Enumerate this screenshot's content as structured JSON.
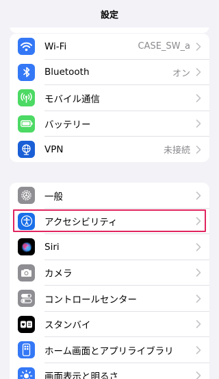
{
  "nav": {
    "title": "設定"
  },
  "group1": [
    {
      "label": "Wi-Fi",
      "value": "CASE_SW_a",
      "icon": "wifi-icon",
      "color": "#3478f6"
    },
    {
      "label": "Bluetooth",
      "value": "オン",
      "icon": "bluetooth-icon",
      "color": "#3478f6"
    },
    {
      "label": "モバイル通信",
      "value": "",
      "icon": "cellular-icon",
      "color": "#4cd964"
    },
    {
      "label": "バッテリー",
      "value": "",
      "icon": "battery-icon",
      "color": "#4cd964"
    },
    {
      "label": "VPN",
      "value": "未接続",
      "icon": "vpn-globe-icon",
      "color": "#1a5fd6"
    }
  ],
  "group2": [
    {
      "label": "一般",
      "icon": "gear-icon",
      "color": "#8e8e93"
    },
    {
      "label": "アクセシビリティ",
      "icon": "accessibility-icon",
      "color": "#1a6fe8"
    },
    {
      "label": "Siri",
      "icon": "siri-icon",
      "color": "#000000"
    },
    {
      "label": "カメラ",
      "icon": "camera-icon",
      "color": "#8e8e93"
    },
    {
      "label": "コントロールセンター",
      "icon": "control-center-icon",
      "color": "#8e8e93"
    },
    {
      "label": "スタンバイ",
      "icon": "standby-icon",
      "color": "#000000"
    },
    {
      "label": "ホーム画面とアプリライブラリ",
      "icon": "home-screen-icon",
      "color": "#3478f6"
    },
    {
      "label": "画面表示と明るさ",
      "icon": "brightness-icon",
      "color": "#3478f6"
    }
  ],
  "highlight_color": "#e0245e"
}
